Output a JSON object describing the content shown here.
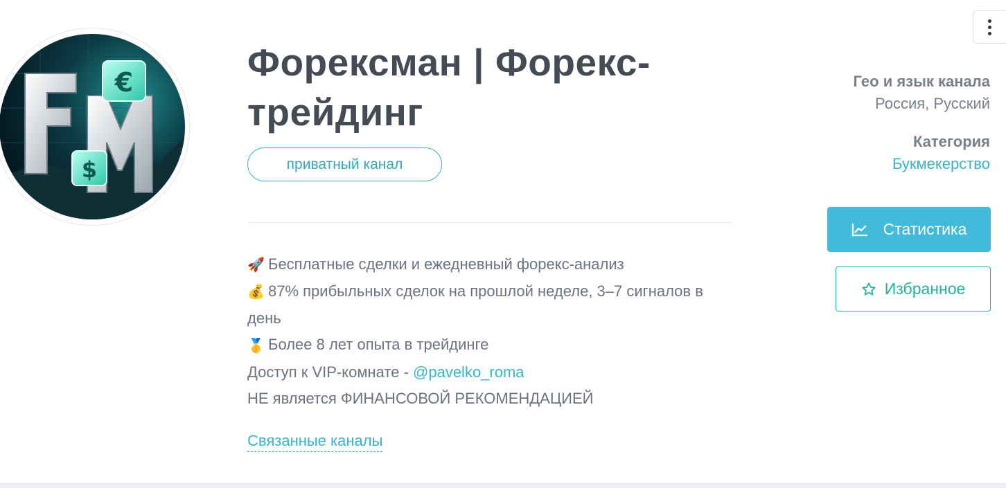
{
  "channel": {
    "title": "Форексман | Форекс-трейдинг",
    "badge": "приватный канал",
    "avatar_letters": "FM"
  },
  "description": {
    "lines": [
      {
        "icon": "rocket-icon",
        "glyph": "🚀",
        "text": "Бесплатные сделки и ежедневный форекс-анализ"
      },
      {
        "icon": "money-bag-icon",
        "glyph": "💰",
        "text": "87% прибыльных сделок на прошлой неделе, 3–7 сигналов в день"
      },
      {
        "icon": "medal-icon",
        "glyph": "🥇",
        "text": "Более 8 лет опыта в трейдинге"
      }
    ],
    "vip_prefix": "Доступ к VIP-комнате - ",
    "vip_link": "@pavelko_roma",
    "disclaimer": "НЕ является ФИНАНСОВОЙ РЕКОМЕНДАЦИЕЙ"
  },
  "related_channels": "Связанные каналы",
  "sidebar": {
    "geo_label": "Гео и язык канала",
    "geo_value": "Россия, Русский",
    "category_label": "Категория",
    "category_value": "Букмекерство",
    "stats_button": "Статистика",
    "favorite_button": "Избранное"
  },
  "colors": {
    "accent": "#36b5c9",
    "stats_button_bg": "#41bbd9",
    "favorite": "#1fb59a",
    "title": "#444b55"
  }
}
